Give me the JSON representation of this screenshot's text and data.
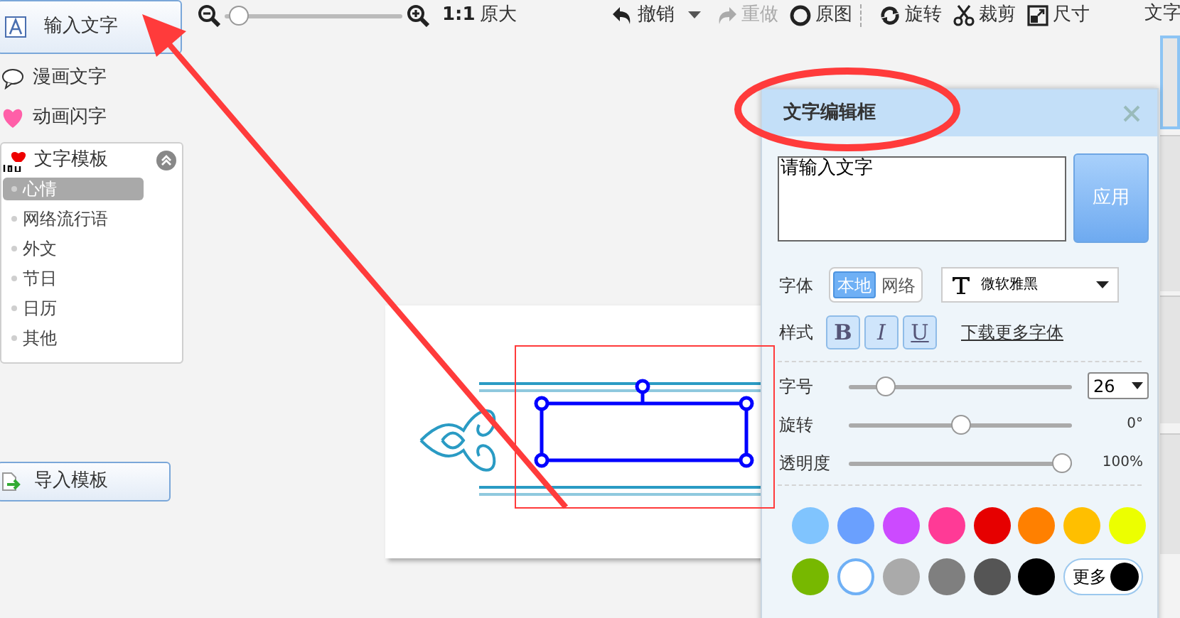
{
  "sidebar": {
    "items": [
      {
        "label": "输入文字",
        "selected": true
      },
      {
        "label": "漫画文字",
        "selected": false
      },
      {
        "label": "动画闪字",
        "selected": false
      }
    ],
    "templates": {
      "title": "文字模板",
      "expanded": true,
      "items": [
        {
          "label": "心情",
          "selected": true
        },
        {
          "label": "网络流行语",
          "selected": false
        },
        {
          "label": "外文",
          "selected": false
        },
        {
          "label": "节日",
          "selected": false
        },
        {
          "label": "日历",
          "selected": false
        },
        {
          "label": "其他",
          "selected": false
        }
      ]
    },
    "import_button": "导入模板"
  },
  "toolbar": {
    "zoom": {
      "level": 0.03
    },
    "ratio": "1:1",
    "actual_size": "原大",
    "actions": [
      {
        "label": "撤销",
        "disabled": false,
        "dropdown": true
      },
      {
        "label": "重做",
        "disabled": true,
        "dropdown": false
      },
      {
        "label": "原图",
        "disabled": false,
        "dropdown": false
      },
      {
        "label": "旋转",
        "disabled": false,
        "dropdown": false
      },
      {
        "label": "裁剪",
        "disabled": false,
        "dropdown": false
      },
      {
        "label": "尺寸",
        "disabled": false,
        "dropdown": false
      }
    ]
  },
  "right_panel": {
    "title": "文字"
  },
  "dialog": {
    "title": "文字编辑框",
    "text_input": {
      "value": "请输入文字"
    },
    "apply_button": "应用",
    "font": {
      "label": "字体",
      "sources": [
        {
          "label": "本地",
          "selected": true
        },
        {
          "label": "网络",
          "selected": false
        }
      ],
      "font_name": "微软雅黑"
    },
    "style": {
      "label": "样式",
      "buttons": [
        {
          "label": "B",
          "on": false
        },
        {
          "label": "I",
          "on": false
        },
        {
          "label": "U",
          "on": false
        }
      ],
      "link": "下载更多字体"
    },
    "sliders": [
      {
        "label": "字号",
        "level": 0.13,
        "select": "26"
      },
      {
        "label": "旋转",
        "level": 0.5,
        "reading": "0°"
      },
      {
        "label": "透明度",
        "level": 1,
        "reading": "100%"
      }
    ],
    "colors": [
      {
        "color": "#80c4fe",
        "selected": false
      },
      {
        "color": "#6aa0fe",
        "selected": false
      },
      {
        "color": "#cc4aff",
        "selected": false
      },
      {
        "color": "#ff3a96",
        "selected": false
      },
      {
        "color": "#e60000",
        "selected": false
      },
      {
        "color": "#ff8000",
        "selected": false
      },
      {
        "color": "#ffbf00",
        "selected": false
      },
      {
        "color": "#ecff00",
        "selected": false
      },
      {
        "color": "#77b800",
        "selected": false
      },
      {
        "color": "#ffffff",
        "selected": true
      },
      {
        "color": "#aaaaaa",
        "selected": false
      },
      {
        "color": "#7f7f7f",
        "selected": false
      },
      {
        "color": "#555555",
        "selected": false
      },
      {
        "color": "#000000",
        "selected": false
      }
    ],
    "more_button": {
      "label": "更多",
      "color": "#000000"
    }
  }
}
